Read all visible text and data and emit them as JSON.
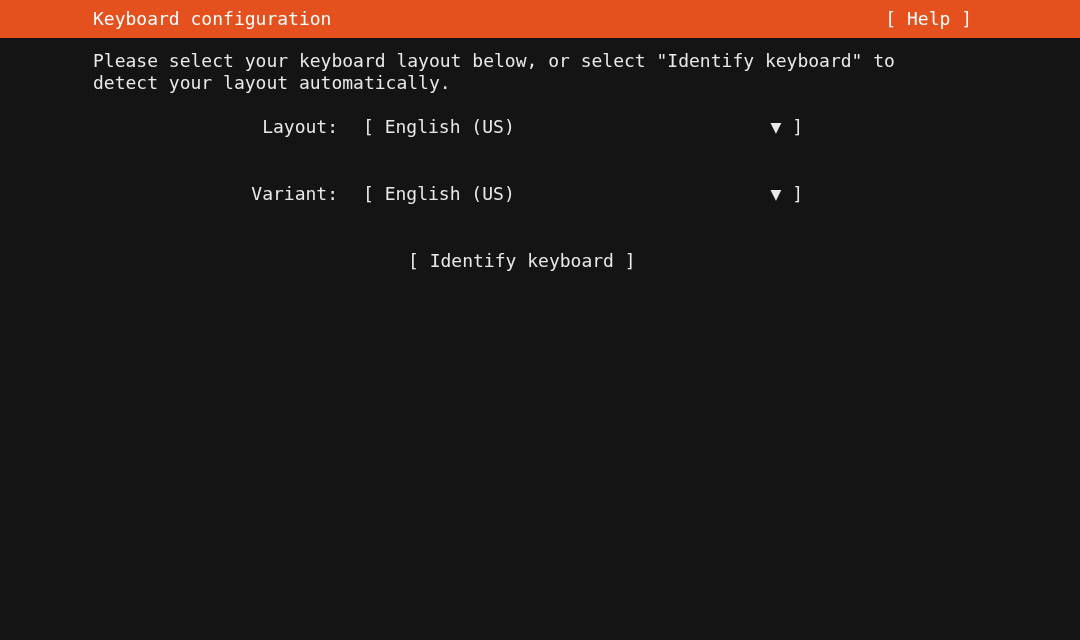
{
  "header": {
    "title": "Keyboard configuration",
    "help": "[ Help ]"
  },
  "intro": "Please select your keyboard layout below, or select \"Identify keyboard\" to detect your layout automatically.",
  "fields": [
    {
      "label": "Layout:",
      "open": "[",
      "value": "English (US)",
      "caret": "▼",
      "close": "]"
    },
    {
      "label": "Variant:",
      "open": "[",
      "value": "English (US)",
      "caret": "▼",
      "close": "]"
    }
  ],
  "identify_button": "[ Identify keyboard ]"
}
